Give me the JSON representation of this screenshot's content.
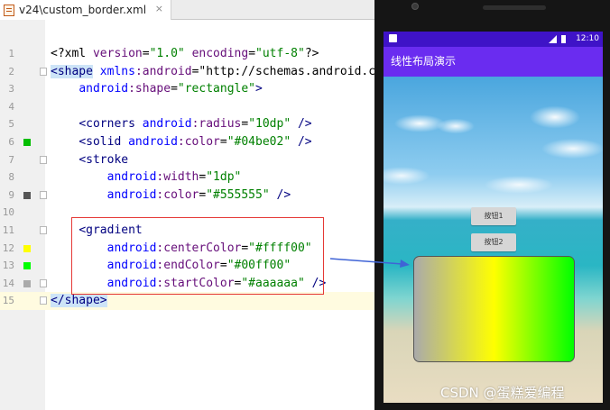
{
  "editor": {
    "tab": {
      "filename": "v24\\custom_border.xml",
      "close": "×"
    },
    "lines": [
      {
        "num": "1",
        "code": "<?xml version=\"1.0\" encoding=\"utf-8\"?>"
      },
      {
        "num": "2",
        "code": "<shape xmlns:android=\"http://schemas.android.com"
      },
      {
        "num": "3",
        "code": "    android:shape=\"rectangle\">"
      },
      {
        "num": "4",
        "code": ""
      },
      {
        "num": "5",
        "code": "    <corners android:radius=\"10dp\" />"
      },
      {
        "num": "6",
        "code": "    <solid android:color=\"#04be02\" />",
        "swatch": "#04be02"
      },
      {
        "num": "7",
        "code": "    <stroke"
      },
      {
        "num": "8",
        "code": "        android:width=\"1dp\""
      },
      {
        "num": "9",
        "code": "        android:color=\"#555555\" />",
        "swatch": "#555555"
      },
      {
        "num": "10",
        "code": ""
      },
      {
        "num": "11",
        "code": "    <gradient"
      },
      {
        "num": "12",
        "code": "        android:centerColor=\"#ffff00\"",
        "swatch": "#ffff00"
      },
      {
        "num": "13",
        "code": "        android:endColor=\"#00ff00\"",
        "swatch": "#00ff00"
      },
      {
        "num": "14",
        "code": "        android:startColor=\"#aaaaaa\" />",
        "swatch": "#aaaaaa"
      },
      {
        "num": "15",
        "code": "</shape>"
      }
    ]
  },
  "phone": {
    "status_time": "12:10",
    "app_title": "线性布局演示",
    "button1_label": "按钮1",
    "button2_label": "按钮2",
    "gradient_box": {
      "start_color": "#aaaaaa",
      "center_color": "#ffff00",
      "end_color": "#00ff00",
      "stroke_color": "#555555"
    }
  },
  "watermark": "CSDN @蛋糕爱编程",
  "colors": {
    "appbar": "#6a2cf0",
    "statusbar": "#3f13c7",
    "highlight_box": "#e53935",
    "arrow": "#3f63d6"
  }
}
